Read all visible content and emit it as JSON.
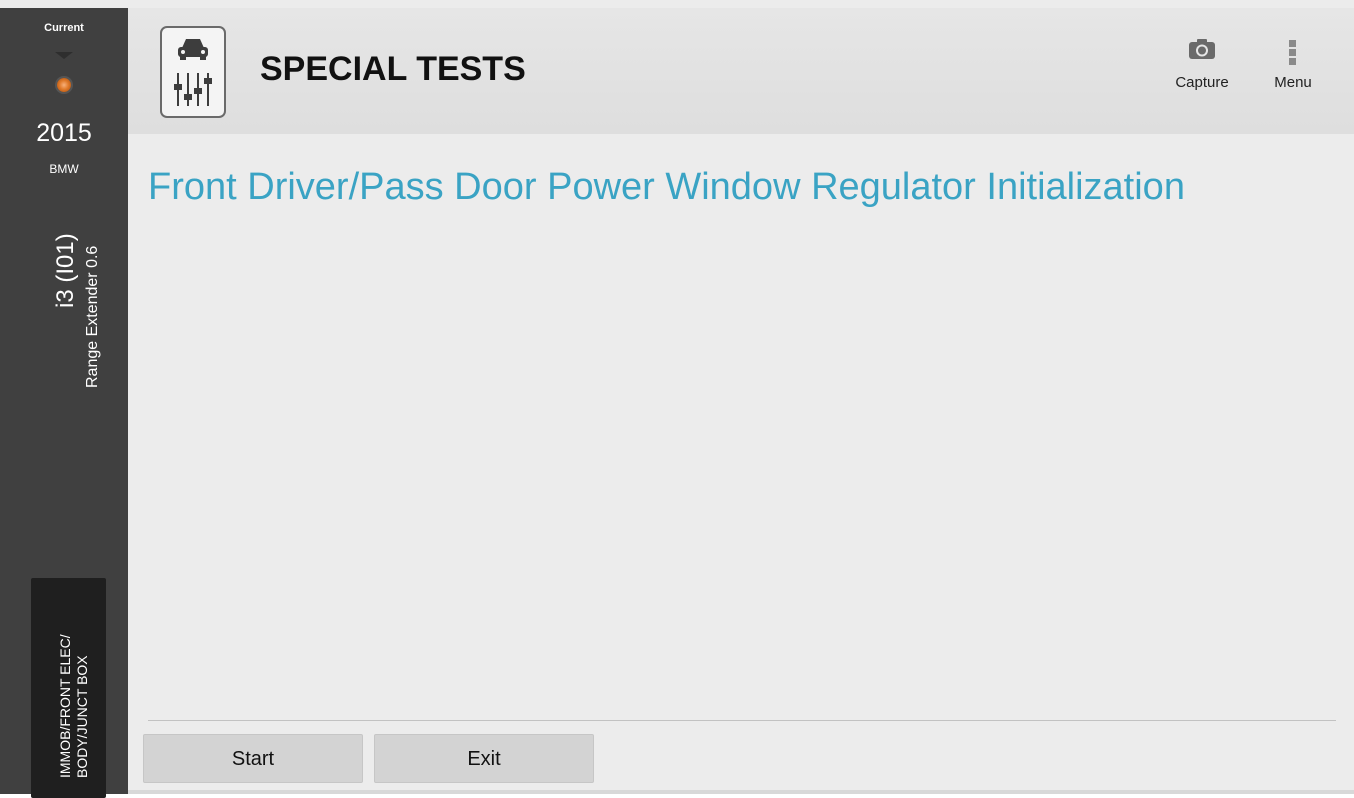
{
  "sidebar": {
    "current_label": "Current",
    "year": "2015",
    "make": "BMW",
    "model": "i3 (I01)",
    "engine": "Range Extender 0.6",
    "module_line1": "IMMOB/FRONT ELEC/",
    "module_line2": "BODY/JUNCT BOX",
    "status_color": "#e07a2a"
  },
  "header": {
    "title": "SPECIAL TESTS",
    "tool_icon": "car-sliders-icon",
    "capture_label": "Capture",
    "capture_icon": "camera-icon",
    "menu_label": "Menu",
    "menu_icon": "vertical-dots-icon"
  },
  "main": {
    "test_title": "Front Driver/Pass Door Power Window Regulator Initialization",
    "title_color": "#3aa3c4"
  },
  "actions": {
    "start_label": "Start",
    "exit_label": "Exit"
  }
}
